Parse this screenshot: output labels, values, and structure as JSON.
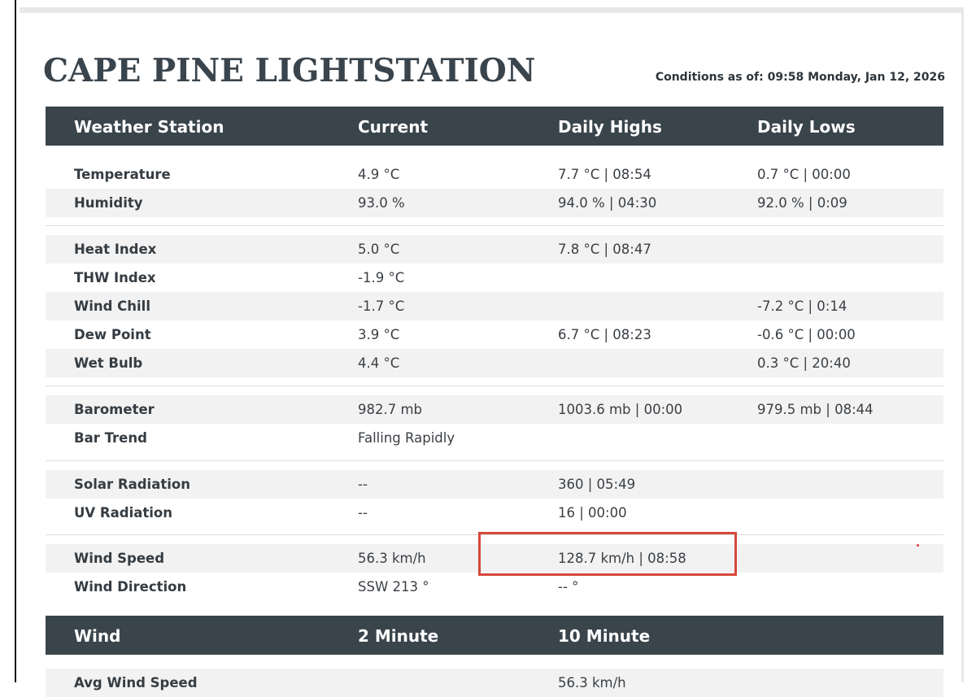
{
  "station_title": "CAPE PINE LIGHTSTATION",
  "conditions": {
    "label": "Conditions as of:",
    "value": "09:58 Monday, Jan 12, 2026"
  },
  "weather_header": [
    "Weather Station",
    "Current",
    "Daily Highs",
    "Daily Lows"
  ],
  "weather_rows": [
    {
      "name": "Temperature",
      "current": "4.9 °C",
      "high": "7.7 °C | 08:54",
      "low": "0.7 °C | 00:00"
    },
    {
      "name": "Humidity",
      "current": "93.0 %",
      "high": "94.0 % | 04:30",
      "low": "92.0 % | 0:09"
    },
    {
      "name": "Heat Index",
      "current": "5.0 °C",
      "high": "7.8 °C | 08:47",
      "low": ""
    },
    {
      "name": "THW Index",
      "current": "-1.9 °C",
      "high": "",
      "low": ""
    },
    {
      "name": "Wind Chill",
      "current": "-1.7 °C",
      "high": "",
      "low": "-7.2 °C | 0:14"
    },
    {
      "name": "Dew Point",
      "current": "3.9 °C",
      "high": "6.7 °C | 08:23",
      "low": "-0.6 °C | 00:00"
    },
    {
      "name": "Wet Bulb",
      "current": "4.4 °C",
      "high": "",
      "low": "0.3 °C | 20:40"
    },
    {
      "name": "Barometer",
      "current": "982.7 mb",
      "high": "1003.6 mb | 00:00",
      "low": "979.5 mb | 08:44"
    },
    {
      "name": "Bar Trend",
      "current": "Falling Rapidly",
      "high": "",
      "low": ""
    },
    {
      "name": "Solar Radiation",
      "current": "--",
      "high": "360 | 05:49",
      "low": ""
    },
    {
      "name": "UV Radiation",
      "current": "--",
      "high": "16 | 00:00",
      "low": ""
    },
    {
      "name": "Wind Speed",
      "current": "56.3 km/h",
      "high": "128.7 km/h | 08:58",
      "low": ""
    },
    {
      "name": "Wind Direction",
      "current": "SSW 213 °",
      "high": "-- °",
      "low": ""
    }
  ],
  "wind_header": [
    "Wind",
    "2 Minute",
    "10 Minute"
  ],
  "wind_rows": [
    {
      "name": "Avg Wind Speed",
      "two_min": "",
      "ten_min": "56.3 km/h"
    }
  ],
  "colors": {
    "header_bg": "#39444b",
    "row_shade": "#f2f2f2",
    "highlight": "#d6473c",
    "title": "#3a444c"
  }
}
